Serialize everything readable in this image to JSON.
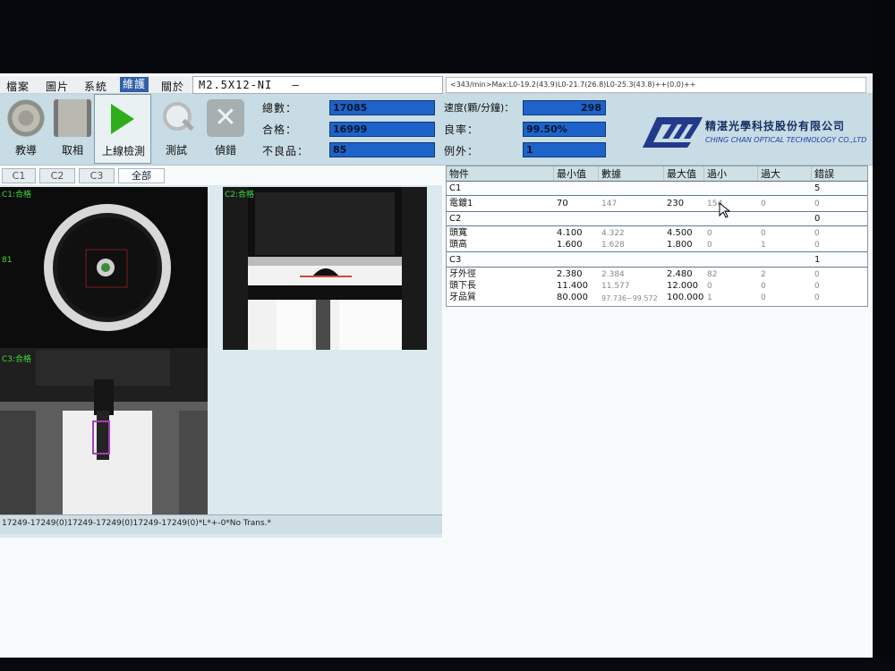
{
  "menu": {
    "items": [
      "檔案",
      "圖片",
      "系統",
      "維護",
      "關於"
    ],
    "model": "M2.5X12-NI",
    "model_suffix": "—"
  },
  "status_line": "<343/min>Max:L0-19.2(43.9)L0-21.7(26.8)L0-25.3(43.8)++(0.0)++",
  "toolbar": {
    "buttons": [
      "教導",
      "取相",
      "上線檢測",
      "測試",
      "偵錯"
    ]
  },
  "stats": {
    "total_label": "總數：",
    "total_value": "17085",
    "pass_label": "合格：",
    "pass_value": "16999",
    "defect_label": "不良品：",
    "defect_value": "85",
    "speed_label": "速度(顆/分鐘)：",
    "speed_value": "298",
    "yield_label": "良率：",
    "yield_value": "99.50%",
    "exception_label": "例外：",
    "exception_value": "1"
  },
  "logo": {
    "cn": "精湛光學科技股份有限公司",
    "en": "CHING CHAN OPTICAL TECHNOLOGY CO.,LTD"
  },
  "camera_tabs": [
    "C1",
    "C2",
    "C3",
    "全部"
  ],
  "cameras": {
    "c1_label": "C1:合格",
    "c1_side_value": "81",
    "c2_label": "C2:合格",
    "c3_label": "C3:合格"
  },
  "bottom_status": "17249-17249(0)17249-17249(0)17249-17249(0)*L*+-0*No Trans.*",
  "table": {
    "headers": [
      "物件",
      "最小值",
      "數據",
      "最大值",
      "過小",
      "過大",
      "錯誤"
    ],
    "groups": [
      {
        "name": "C1",
        "error": "5",
        "rows": [
          {
            "item": "電鍍1",
            "min": "70",
            "value": "147",
            "max": "230",
            "under": "154",
            "over": "0",
            "error": "0"
          }
        ]
      },
      {
        "name": "C2",
        "error": "0",
        "rows": [
          {
            "item": "頭寬",
            "min": "4.100",
            "value": "4.322",
            "max": "4.500",
            "under": "0",
            "over": "0",
            "error": "0"
          },
          {
            "item": "頭高",
            "min": "1.600",
            "value": "1.628",
            "max": "1.800",
            "under": "0",
            "over": "1",
            "error": "0"
          }
        ]
      },
      {
        "name": "C3",
        "error": "1",
        "rows": [
          {
            "item": "牙外徑",
            "min": "2.380",
            "value": "2.384",
            "max": "2.480",
            "under": "82",
            "over": "2",
            "error": "0"
          },
          {
            "item": "頭下長",
            "min": "11.400",
            "value": "11.577",
            "max": "12.000",
            "under": "0",
            "over": "0",
            "error": "0"
          },
          {
            "item": "牙品質",
            "min": "80.000",
            "value": "97.736~99.572",
            "max": "100.000",
            "under": "1",
            "over": "0",
            "error": "0"
          }
        ]
      }
    ]
  }
}
